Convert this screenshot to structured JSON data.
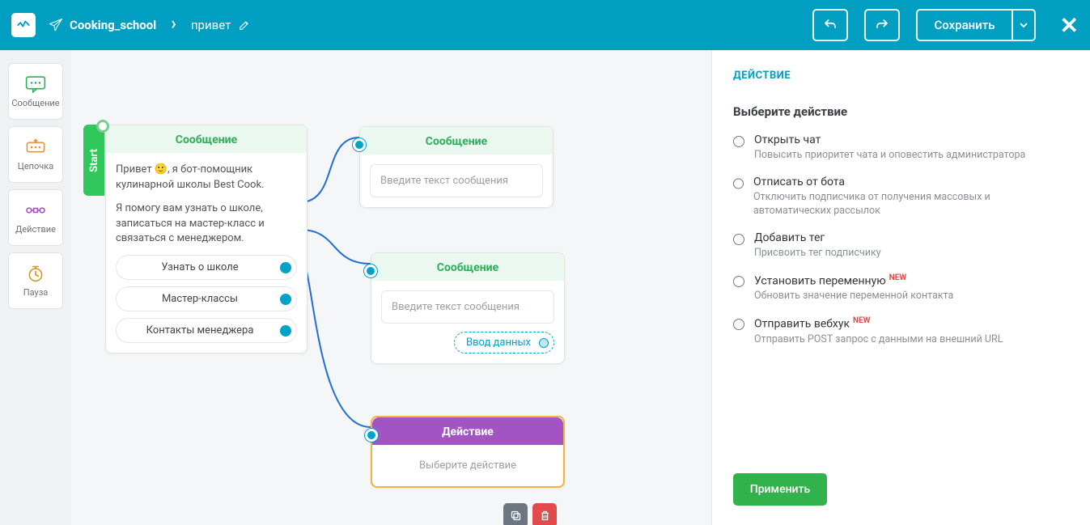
{
  "header": {
    "project": "Cooking_school",
    "flow_name": "привет",
    "save_label": "Сохранить"
  },
  "palette": {
    "message": "Сообщение",
    "chain": "Цепочка",
    "action": "Действие",
    "pause": "Пауза"
  },
  "start": {
    "label": "Start"
  },
  "node1": {
    "title": "Сообщение",
    "text1": "Привет 🙂, я бот-помощник кулинарной школы Best Cook.",
    "text2": "Я помогу вам узнать о школе, записаться на мастер-класс и связаться с менеджером.",
    "options": [
      "Узнать о школе",
      "Мастер-классы",
      "Контакты менеджера"
    ]
  },
  "node2": {
    "title": "Сообщение",
    "placeholder": "Введите текст сообщения"
  },
  "node3": {
    "title": "Сообщение",
    "placeholder": "Введите текст сообщения",
    "chip": "Ввод данных"
  },
  "node4": {
    "title": "Действие",
    "placeholder": "Выберите действие"
  },
  "panel": {
    "title": "ДЕЙСТВИЕ",
    "subtitle": "Выберите действие",
    "options": [
      {
        "title": "Открыть чат",
        "desc": "Повысить приоритет чата и оповестить администратора",
        "new": false
      },
      {
        "title": "Отписать от бота",
        "desc": "Отключить подписчика от получения массовых и автоматических рассылок",
        "new": false
      },
      {
        "title": "Добавить тег",
        "desc": "Присвоить тег подписчику",
        "new": false
      },
      {
        "title": "Установить переменную",
        "desc": "Обновить значение переменной контакта",
        "new": true
      },
      {
        "title": "Отправить вебхук",
        "desc": "Отправить POST запрос с данными на внешний URL",
        "new": true
      }
    ],
    "new_badge": "NEW",
    "apply": "Применить"
  }
}
